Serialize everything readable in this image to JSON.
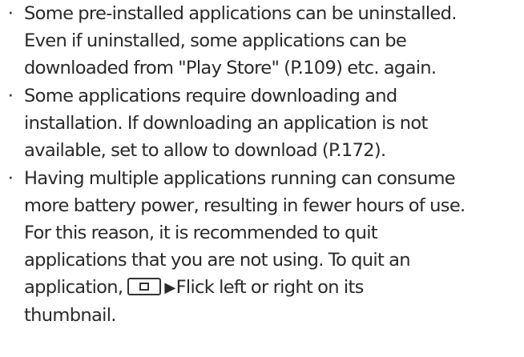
{
  "notes": [
    {
      "bullet": "·",
      "lines": [
        "Some pre-installed applications can be uninstalled.",
        "Even if uninstalled, some applications can be",
        "downloaded from \"Play Store\" (P.109) etc. again."
      ]
    },
    {
      "bullet": "·",
      "lines": [
        "Some applications require downloading and",
        "installation. If downloading an application is not",
        "available, set to allow to download (P.172)."
      ]
    },
    {
      "bullet": "·",
      "lines": [
        "Having multiple applications running can consume",
        "more battery power, resulting in fewer hours of use.",
        "For this reason, it is recommended to quit",
        "applications that you are not using. To quit an",
        "application,",
        "Flick left or right on its",
        "thumbnail."
      ]
    }
  ],
  "icons": {
    "recent_apps_key": "recent-apps-key-icon",
    "step_arrow": "▶"
  }
}
